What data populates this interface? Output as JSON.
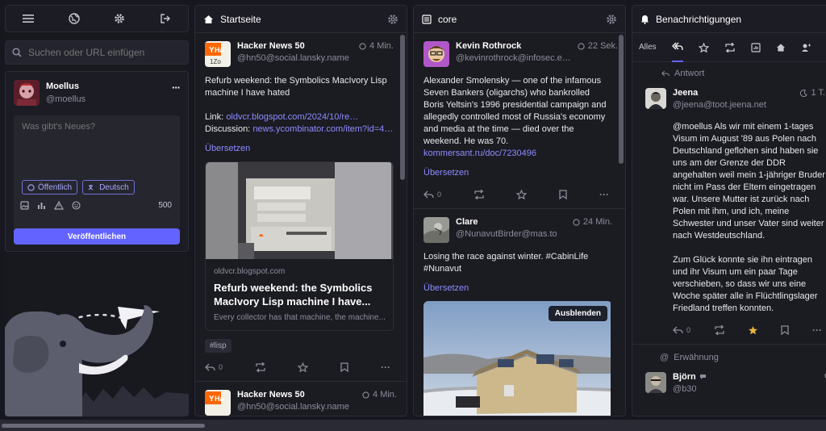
{
  "search": {
    "placeholder": "Suchen oder URL einfügen"
  },
  "account": {
    "name": "Moellus",
    "handle": "@moellus",
    "more": "···"
  },
  "compose": {
    "placeholder": "Was gibt's Neues?",
    "visibility": "Öffentlich",
    "language": "Deutsch",
    "char_count": "500",
    "publish_label": "Veröffentlichen"
  },
  "home": {
    "title": "Startseite",
    "posts": [
      {
        "name": "Hacker News 50",
        "handle": "@hn50@social.lansky.name",
        "time": "4 Min.",
        "body": "Refurb weekend: the Symbolics MacIvory Lisp machine I have hated",
        "link_label": "Link:",
        "link": "oldvcr.blogspot.com/2024/10/re…",
        "discussion_label": "Discussion:",
        "discussion": "news.ycombinator.com/item?id=4…",
        "translate": "Übersetzen",
        "card_domain": "oldvcr.blogspot.com",
        "card_title": "Refurb weekend: the Symbolics MacIvory Lisp machine I have...",
        "card_desc": "Every collector has that machine, the machine...",
        "hashtag": "#lisp",
        "reply_count": "0"
      },
      {
        "name": "Hacker News 50",
        "handle": "@hn50@social.lansky.name",
        "time": "4 Min."
      }
    ]
  },
  "core": {
    "title": "core",
    "posts": [
      {
        "name": "Kevin Rothrock",
        "handle": "@kevinrothrock@infosec.e…",
        "time": "22 Sek.",
        "body": "Alexander Smolensky — one of the infamous Seven Bankers (oligarchs) who bankrolled Boris Yeltsin's 1996 presidential campaign and allegedly controlled most of Russia's economy and media at the time — died over the weekend. He was 70.",
        "link": "kommersant.ru/doc/7230496",
        "translate": "Übersetzen",
        "reply_count": "0"
      },
      {
        "name": "Clare",
        "handle": "@NunavutBirder@mas.to",
        "time": "24 Min.",
        "body": "Losing the race against winter. #CabinLife #Nunavut",
        "translate": "Übersetzen",
        "hide_label": "Ausblenden"
      }
    ]
  },
  "notifications": {
    "title": "Benachrichtigungen",
    "tab_all": "Alles",
    "items": [
      {
        "kind": "Antwort",
        "name": "Jeena",
        "handle": "@jeena@toot.jeena.net",
        "time": "1 T.",
        "mention": "@moellus",
        "body": "Als wir mit einem 1-tages Visum im August '89 aus Polen nach Deutschland geflohen sind haben sie uns am der Grenze der DDR angehalten weil mein 1-jähriger Bruder nicht im Pass der Eltern eingetragen war. Unsere Mutter ist zurück nach Polen mit ihm, und ich, meine Schwester und unser Vater sind weiter nach Westdeutschland.",
        "body2": "Zum Glück konnte sie ihn eintragen und ihr Visum um ein paar Tage verschieben, so dass wir uns eine Woche später alle in Flüchtlingslager Friedland treffen konnten.",
        "reply_count": "0"
      },
      {
        "kind": "Erwähnung",
        "name": "Björn",
        "handle": "@b30"
      }
    ]
  },
  "colors": {
    "accent": "#6364ff",
    "background": "#17171f",
    "panel": "#1b1b22",
    "star": "#e8b53a"
  }
}
